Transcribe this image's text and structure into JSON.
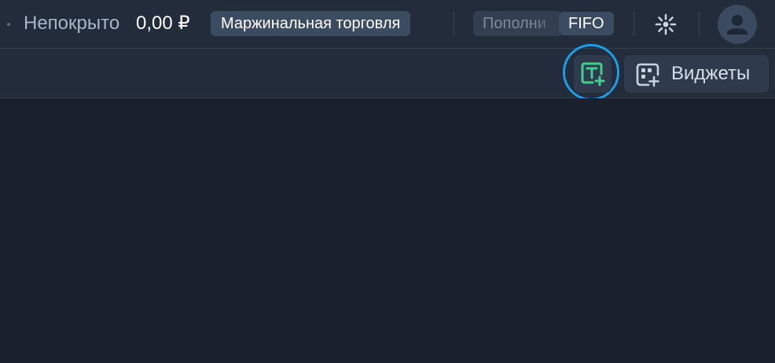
{
  "header": {
    "uncovered_label": "Непокрыто",
    "uncovered_value": "0,00 ₽",
    "margin_badge": "Маржинальная торговля",
    "topup_label": "Пополни",
    "fifo_badge": "FIFO",
    "settings_icon": "sun-gear-icon",
    "avatar_icon": "user-icon"
  },
  "toolbar": {
    "new_terminal_icon": "terminal-add-icon",
    "widgets_icon": "widgets-add-icon",
    "widgets_label": "Виджеты"
  },
  "colors": {
    "background": "#1a212d",
    "panel": "#222c3b",
    "badge": "#3b4b60",
    "accent_green": "#3ccf8e",
    "highlight_blue": "#1a9ee8"
  }
}
